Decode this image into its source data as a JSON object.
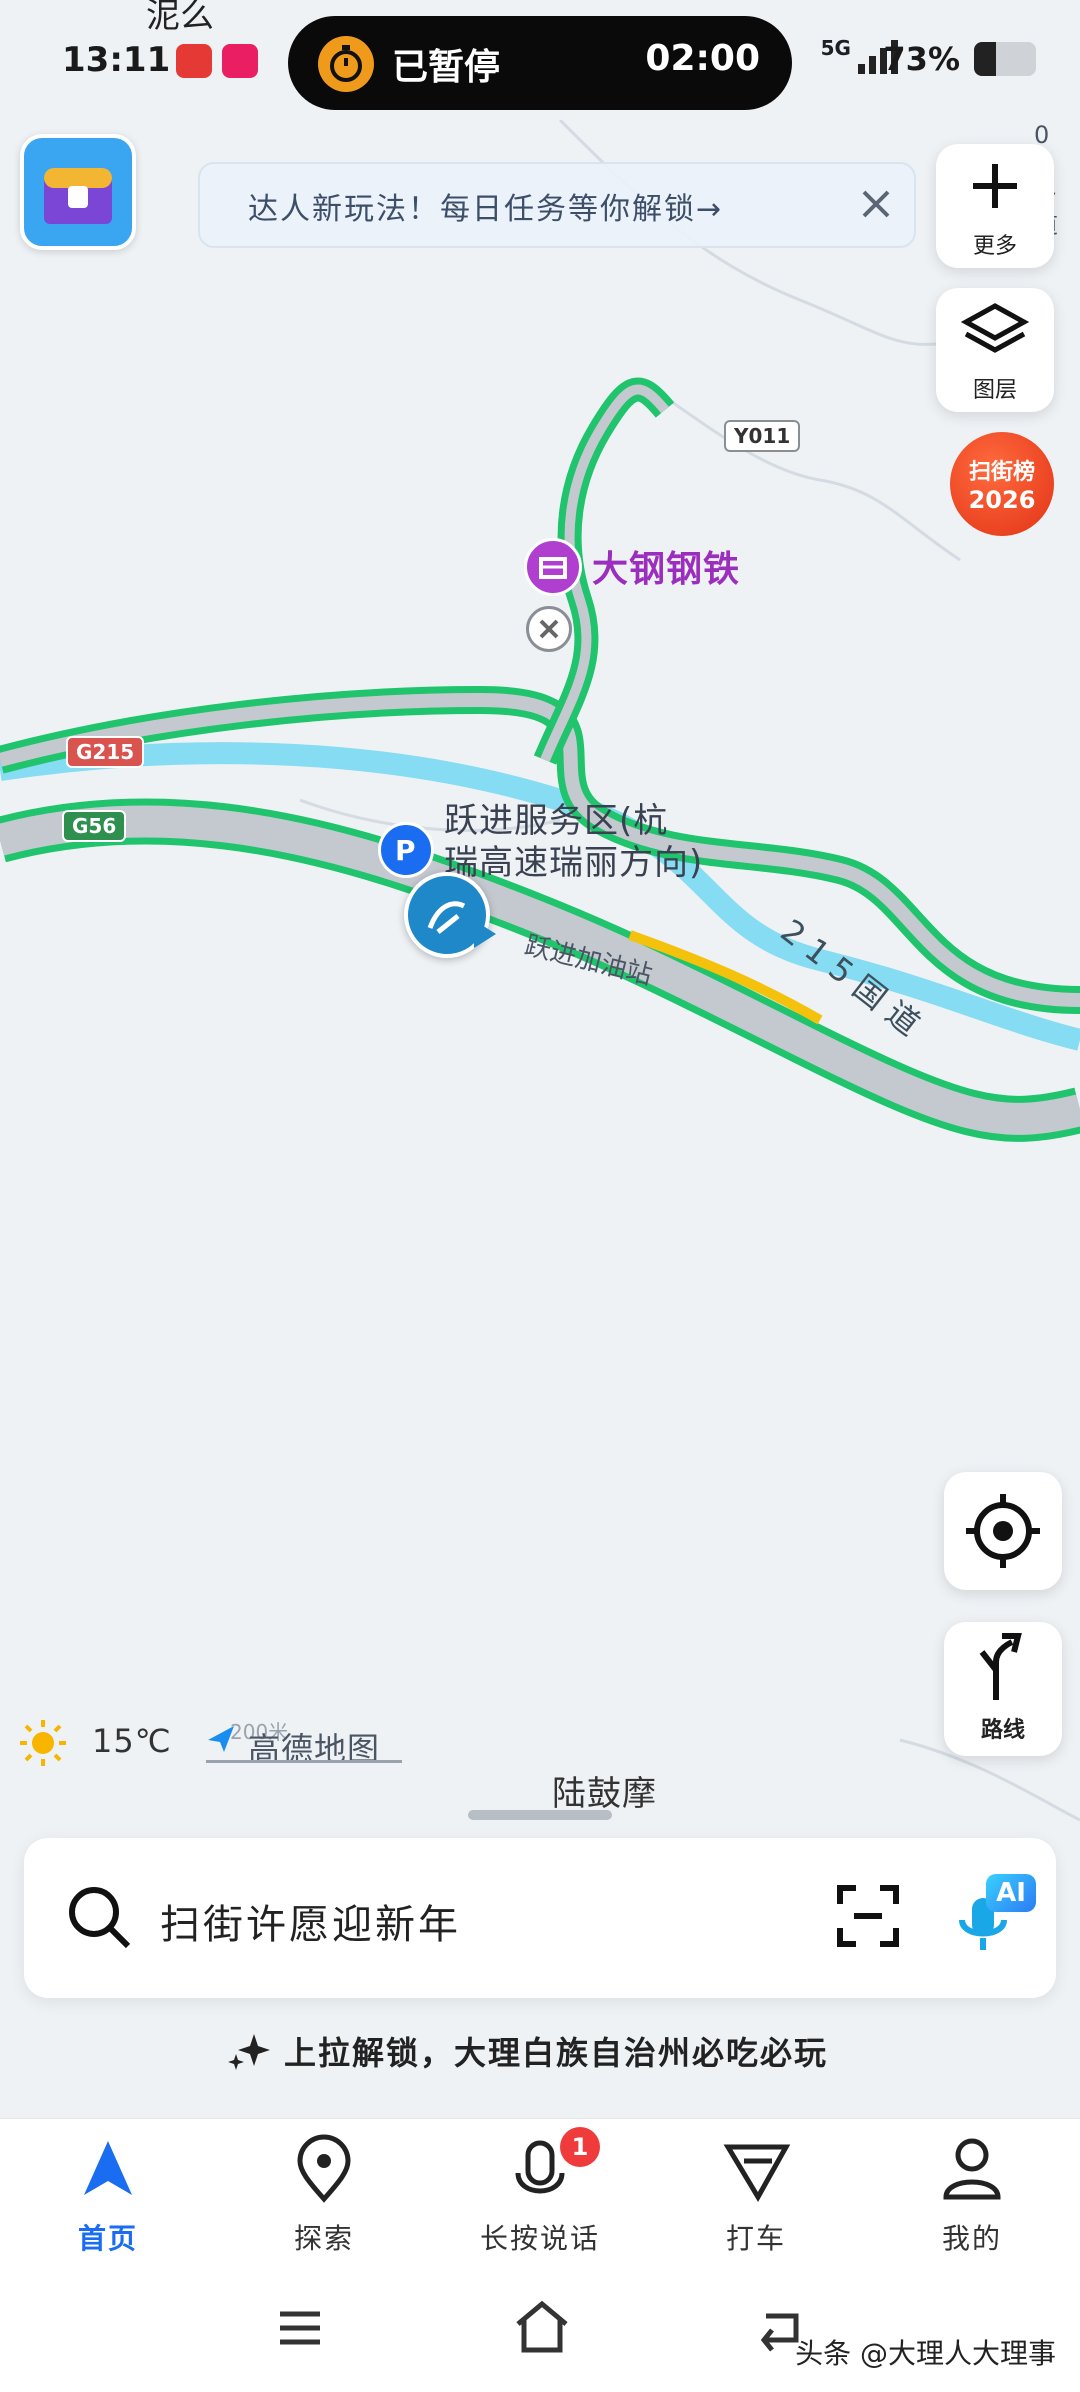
{
  "status_bar": {
    "top_text": "泥么",
    "time": "13:11",
    "timer_state": "已暂停",
    "timer_value": "02:00",
    "network": "5G",
    "battery": "73%"
  },
  "map": {
    "notice": "达人新玩法！每日任务等你解锁→",
    "poi_steel": "大钢钢铁",
    "service_area_line1": "跃进服务区(杭",
    "service_area_line2": "瑞高速瑞丽方向)",
    "gas_station": "跃进加油站",
    "road_215": "215国道",
    "shield_g215": "G215",
    "shield_g56": "G56",
    "shield_y011": "Y011",
    "right_edge_text": "0 1 乡道",
    "place_bottom": "陆鼓摩",
    "weather_temp": "15℃",
    "brand": "高德地图",
    "scale": "200米",
    "colors": {
      "road_green": "#1fc46c",
      "road_slow": "#f4c20d",
      "river": "#7fd8f0",
      "accent": "#1a6cf0",
      "poi_purple": "#b03fcf"
    }
  },
  "controls": {
    "more_label": "更多",
    "layers_label": "图层",
    "badge_line1": "扫街榜",
    "badge_line2": "2026",
    "route_label": "路线"
  },
  "search": {
    "placeholder": "扫街许愿迎新年",
    "ai_label": "AI",
    "hint": "上拉解锁，大理白族自治州必吃必玩"
  },
  "bottom_nav": {
    "items": [
      {
        "label": "首页"
      },
      {
        "label": "探索"
      },
      {
        "label": "长按说话",
        "badge": "1"
      },
      {
        "label": "打车"
      },
      {
        "label": "我的"
      }
    ]
  },
  "watermark": "头条 @大理人大理事"
}
